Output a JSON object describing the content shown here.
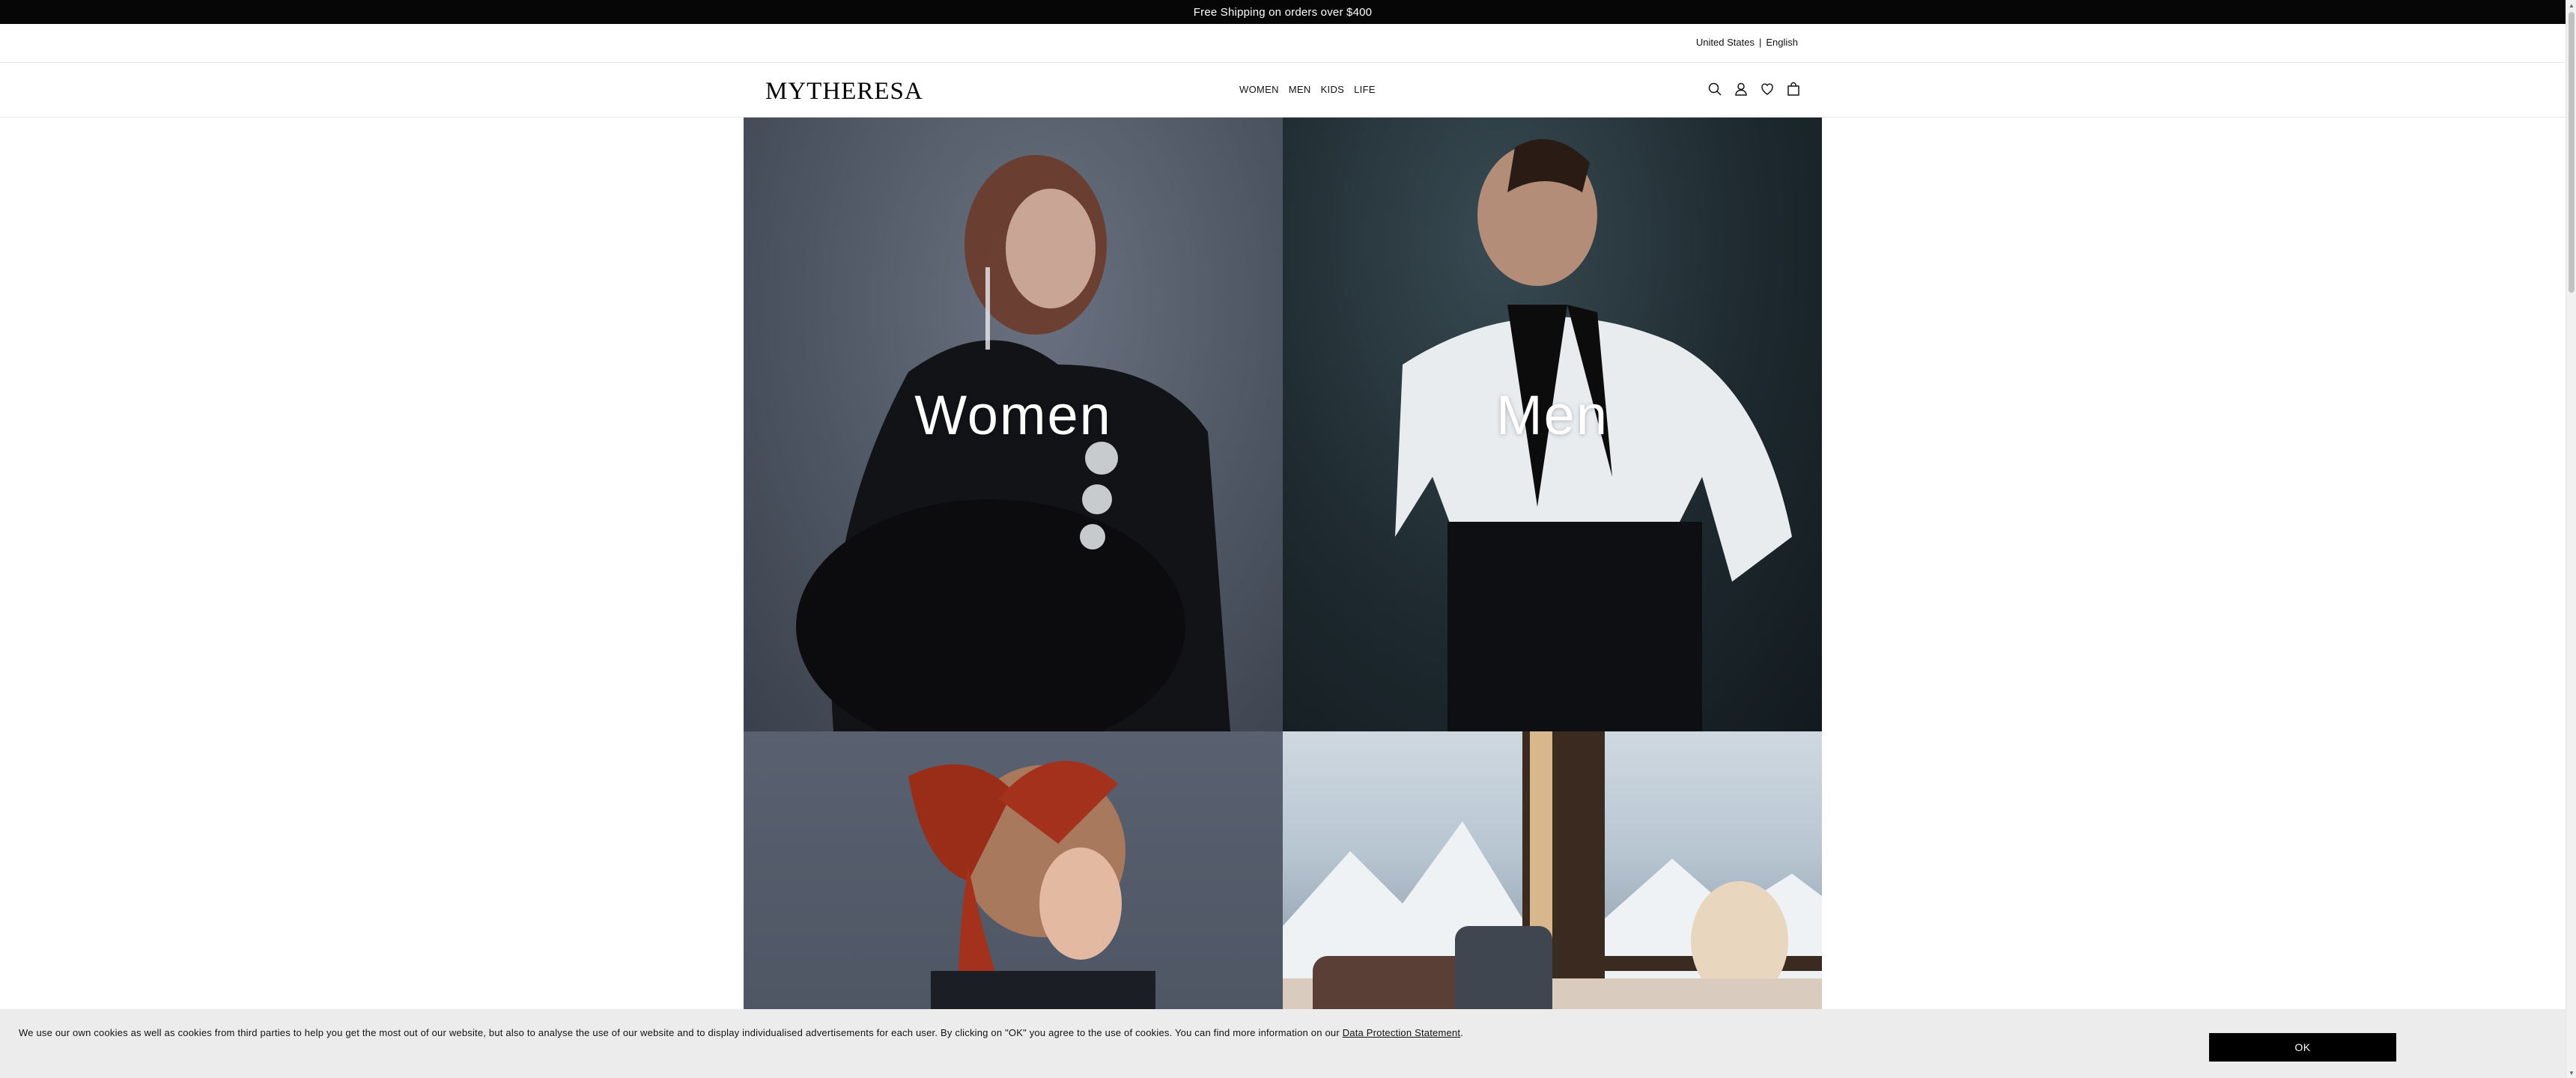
{
  "promo": {
    "text": "Free Shipping on orders over $400"
  },
  "locale": {
    "country": "United States",
    "separator": "|",
    "language": "English"
  },
  "header": {
    "logo": "MYTHERESA",
    "nav": [
      "WOMEN",
      "MEN",
      "KIDS",
      "LIFE"
    ],
    "icons": [
      "search-icon",
      "account-icon",
      "wishlist-heart-icon",
      "shopping-bag-icon"
    ]
  },
  "tiles": [
    {
      "label": "Women"
    },
    {
      "label": "Men"
    },
    {
      "label": ""
    },
    {
      "label": ""
    }
  ],
  "cookie": {
    "text": "We use our own cookies as well as cookies from third parties to help you get the most out of our website, but also to analyse the use of our website and to display individualised advertisements for each user. By clicking on \"OK\" you agree to the use of cookies. You can find more information on our ",
    "link": "Data Protection Statement",
    "suffix": ".",
    "ok_label": "OK"
  }
}
